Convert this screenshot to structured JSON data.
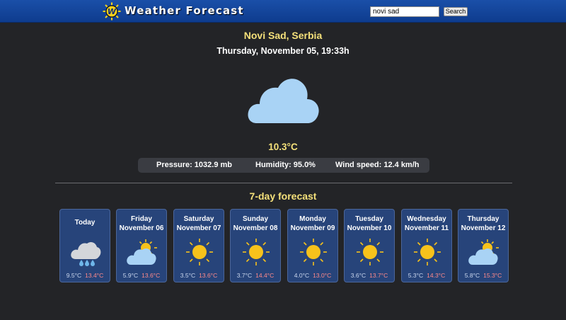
{
  "header": {
    "title": "Weather Forecast",
    "logo_letter": "W",
    "search_value": "novi sad",
    "search_button": "Search"
  },
  "current": {
    "location": "Novi Sad, Serbia",
    "datetime": "Thursday, November 05, 19:33h",
    "icon": "cloud-icon",
    "temperature": "10.3°C",
    "pressure": "Pressure: 1032.9 mb",
    "humidity": "Humidity: 95.0%",
    "wind": "Wind speed: 12.4 km/h"
  },
  "forecast": {
    "title": "7-day forecast",
    "days": [
      {
        "day": "Today",
        "date": "",
        "icon": "rain-cloud-icon",
        "min": "9.5°C",
        "max": "13.4°C"
      },
      {
        "day": "Friday",
        "date": "November 06",
        "icon": "partly-cloudy-icon",
        "min": "5.9°C",
        "max": "13.6°C"
      },
      {
        "day": "Saturday",
        "date": "November 07",
        "icon": "sun-icon",
        "min": "3.5°C",
        "max": "13.6°C"
      },
      {
        "day": "Sunday",
        "date": "November 08",
        "icon": "sun-icon",
        "min": "3.7°C",
        "max": "14.4°C"
      },
      {
        "day": "Monday",
        "date": "November 09",
        "icon": "sun-icon",
        "min": "4.0°C",
        "max": "13.0°C"
      },
      {
        "day": "Tuesday",
        "date": "November 10",
        "icon": "sun-icon",
        "min": "3.6°C",
        "max": "13.7°C"
      },
      {
        "day": "Wednesday",
        "date": "November 11",
        "icon": "sun-icon",
        "min": "5.3°C",
        "max": "14.3°C"
      },
      {
        "day": "Thursday",
        "date": "November 12",
        "icon": "partly-cloudy-icon",
        "min": "5.8°C",
        "max": "15.3°C"
      }
    ]
  },
  "colors": {
    "background": "#232427",
    "header": "#1a4fa8",
    "accent_yellow": "#f4e07a",
    "card": "#27447a",
    "max_temp": "#ff8a8a",
    "cloud": "#a9d3f5",
    "sun": "#f7c21b"
  }
}
